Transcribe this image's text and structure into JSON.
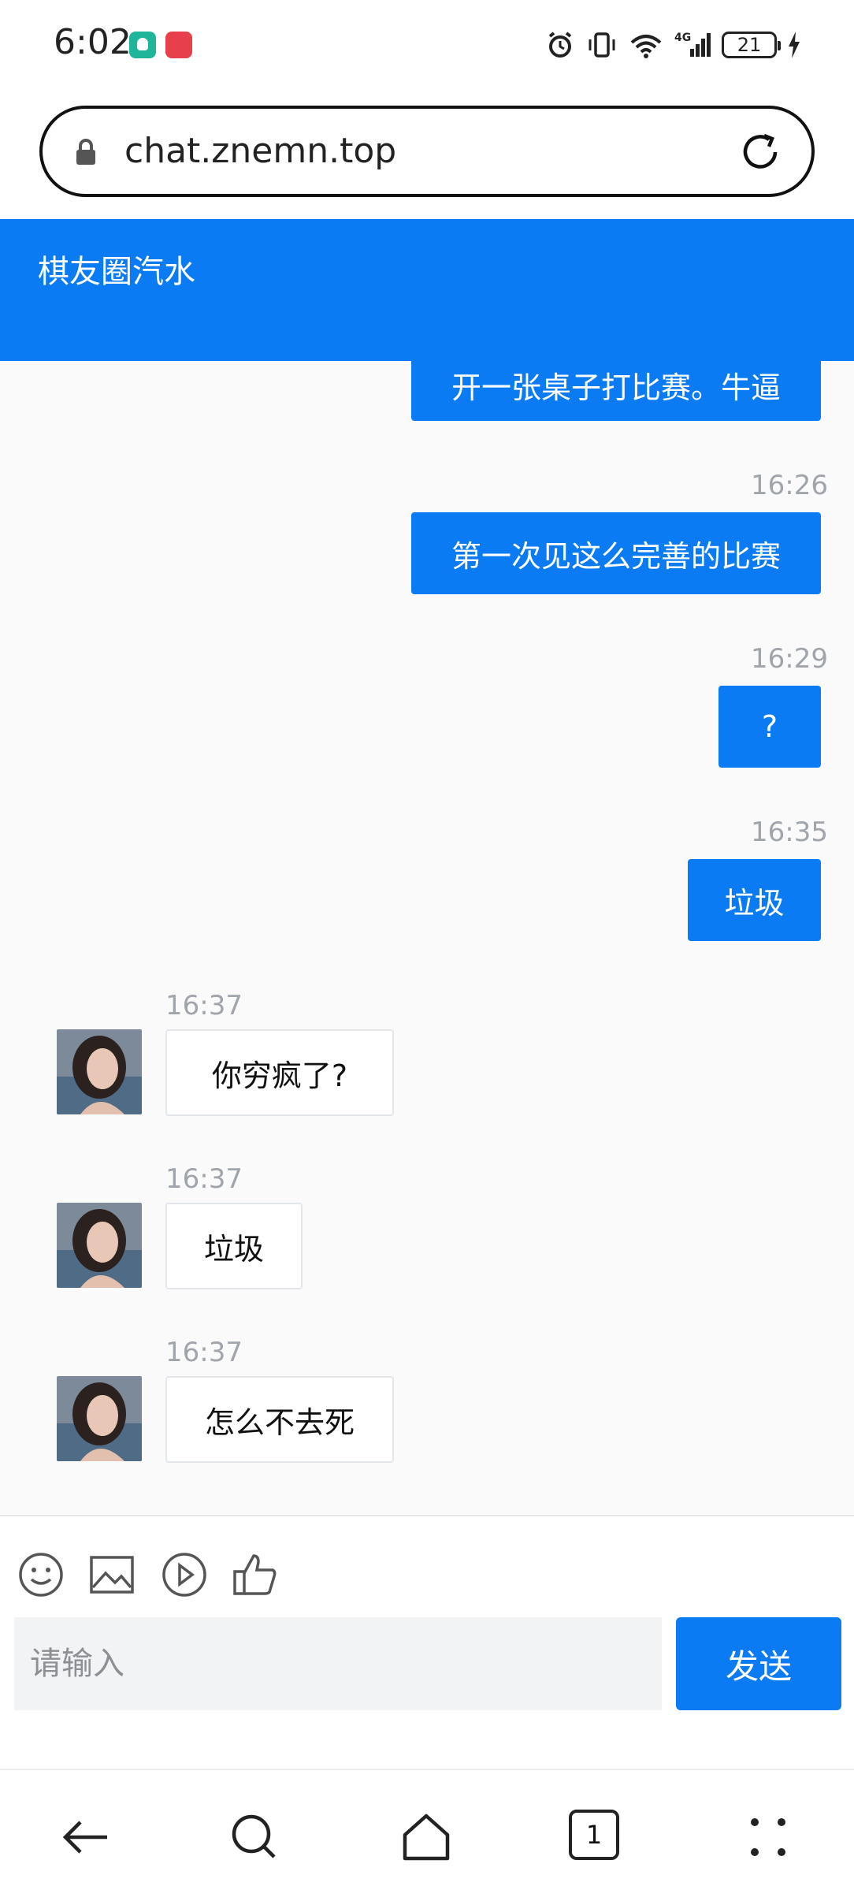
{
  "status_bar": {
    "time": "6:02",
    "battery": "21"
  },
  "browser": {
    "url": "chat.znemn.top"
  },
  "chat": {
    "title": "棋友圈汽水",
    "input_placeholder": "请输入",
    "send_label": "发送",
    "messages": [
      {
        "side": "out",
        "time": "",
        "text": "开一张桌子打比赛。牛逼"
      },
      {
        "side": "out",
        "time": "16:26",
        "text": "第一次见这么完善的比赛"
      },
      {
        "side": "out",
        "time": "16:29",
        "text": "?"
      },
      {
        "side": "out",
        "time": "16:35",
        "text": "垃圾"
      },
      {
        "side": "in",
        "time": "16:37",
        "text": "你穷疯了?"
      },
      {
        "side": "in",
        "time": "16:37",
        "text": "垃圾"
      },
      {
        "side": "in",
        "time": "16:37",
        "text": "怎么不去死"
      }
    ]
  },
  "navigation": {
    "tab_count": "1"
  },
  "colors": {
    "accent": "#0a7bf3",
    "background": "#fafafa",
    "timestamp": "#a0a4ab"
  }
}
